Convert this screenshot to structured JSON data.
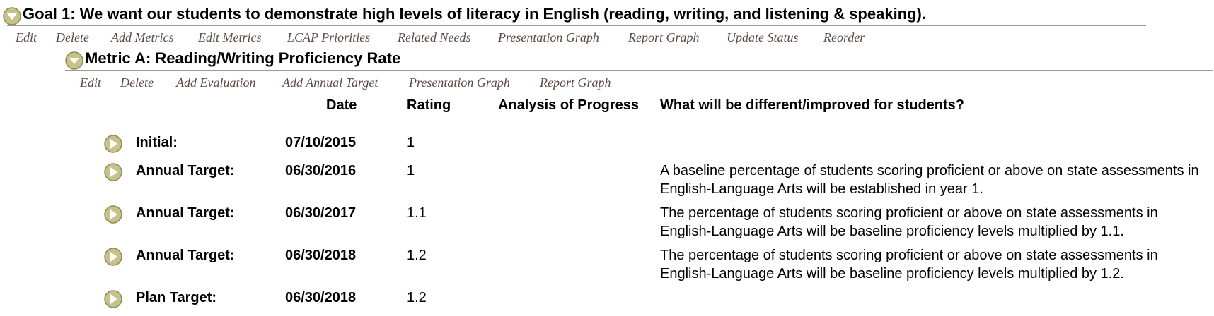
{
  "goal": {
    "title": "Goal 1: We want our students to demonstrate high levels of literacy in English (reading, writing, and listening & speaking).",
    "actions": [
      "Edit",
      "Delete",
      "Add Metrics",
      "Edit Metrics",
      "LCAP Priorities",
      "Related Needs",
      "Presentation Graph",
      "Report Graph",
      "Update Status",
      "Reorder"
    ]
  },
  "metric": {
    "title": "Metric A: Reading/Writing Proficiency Rate",
    "actions": [
      "Edit",
      "Delete",
      "Add Evaluation",
      "Add Annual Target",
      "Presentation Graph",
      "Report Graph"
    ]
  },
  "table": {
    "headers": {
      "date": "Date",
      "rating": "Rating",
      "analysis": "Analysis of Progress",
      "improved": "What will be different/improved for students?"
    },
    "rows": [
      {
        "label": "Initial:",
        "date": "07/10/2015",
        "rating": "1",
        "description": ""
      },
      {
        "label": "Annual Target:",
        "date": "06/30/2016",
        "rating": "1",
        "description": "A baseline percentage of students scoring proficient or above on state assessments in English-Language Arts will be established in year 1."
      },
      {
        "label": "Annual Target:",
        "date": "06/30/2017",
        "rating": "1.1",
        "description": "The percentage of students scoring proficient or above on state assessments in English-Language Arts will be baseline proficiency levels multiplied by 1.1."
      },
      {
        "label": "Annual Target:",
        "date": "06/30/2018",
        "rating": "1.2",
        "description": "The percentage of students scoring proficient or above on state assessments in English-Language Arts will be baseline proficiency levels multiplied by 1.2."
      },
      {
        "label": "Plan Target:",
        "date": "06/30/2018",
        "rating": "1.2",
        "description": ""
      }
    ]
  },
  "colors": {
    "icon_fill": "#c7c28a",
    "icon_edge": "#8f8a55",
    "link": "#5c4a45",
    "rule": "#9a9a9a"
  }
}
